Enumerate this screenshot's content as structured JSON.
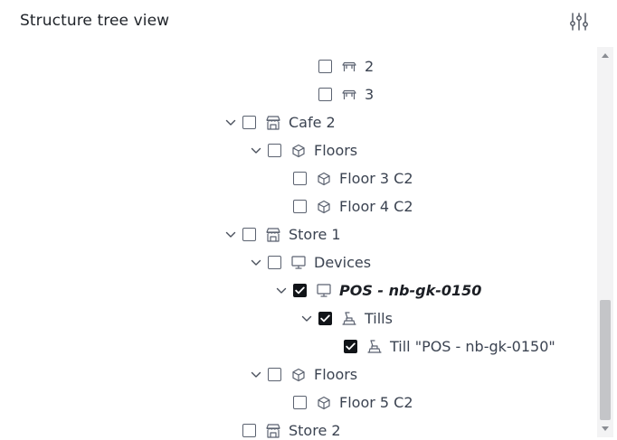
{
  "header": {
    "title": "Structure tree view",
    "settings_icon": "sliders-icon"
  },
  "colors": {
    "text": "#3b4351",
    "checkbox_checked": "#111418",
    "scrollbar_track": "#f3f3f4",
    "scrollbar_thumb": "#c4c5c8"
  },
  "tree": {
    "rows": [
      {
        "label": "2",
        "icon": "table-icon",
        "level": 4,
        "expandable": false,
        "expanded": false,
        "checked": false,
        "selected": false
      },
      {
        "label": "3",
        "icon": "table-icon",
        "level": 4,
        "expandable": false,
        "expanded": false,
        "checked": false,
        "selected": false
      },
      {
        "label": "Cafe 2",
        "icon": "store-icon",
        "level": 1,
        "expandable": true,
        "expanded": true,
        "checked": false,
        "selected": false
      },
      {
        "label": "Floors",
        "icon": "cube-icon",
        "level": 2,
        "expandable": true,
        "expanded": true,
        "checked": false,
        "selected": false
      },
      {
        "label": "Floor 3 C2",
        "icon": "cube-icon",
        "level": 3,
        "expandable": false,
        "expanded": false,
        "checked": false,
        "selected": false
      },
      {
        "label": "Floor 4 C2",
        "icon": "cube-icon",
        "level": 3,
        "expandable": false,
        "expanded": false,
        "checked": false,
        "selected": false
      },
      {
        "label": "Store 1",
        "icon": "store-icon",
        "level": 1,
        "expandable": true,
        "expanded": true,
        "checked": false,
        "selected": false
      },
      {
        "label": "Devices",
        "icon": "monitor-icon",
        "level": 2,
        "expandable": true,
        "expanded": true,
        "checked": false,
        "selected": false
      },
      {
        "label": "POS - nb-gk-0150",
        "icon": "monitor-icon",
        "level": 3,
        "expandable": true,
        "expanded": true,
        "checked": true,
        "selected": true
      },
      {
        "label": "Tills",
        "icon": "till-icon",
        "level": 4,
        "expandable": true,
        "expanded": true,
        "checked": true,
        "selected": false
      },
      {
        "label": "Till \"POS - nb-gk-0150\"",
        "icon": "till-icon",
        "level": 5,
        "expandable": false,
        "expanded": false,
        "checked": true,
        "selected": false
      },
      {
        "label": "Floors",
        "icon": "cube-icon",
        "level": 2,
        "expandable": true,
        "expanded": true,
        "checked": false,
        "selected": false
      },
      {
        "label": "Floor 5 C2",
        "icon": "cube-icon",
        "level": 3,
        "expandable": false,
        "expanded": false,
        "checked": false,
        "selected": false
      },
      {
        "label": "Store 2",
        "icon": "store-icon",
        "level": 1,
        "expandable": false,
        "expanded": false,
        "checked": false,
        "selected": false
      }
    ]
  }
}
